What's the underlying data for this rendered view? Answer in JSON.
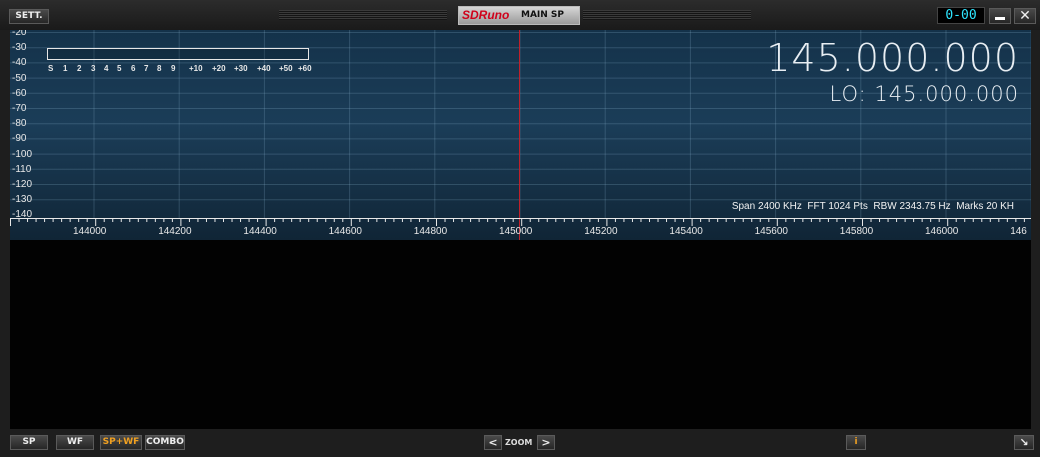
{
  "window": {
    "brand": "SDRuno",
    "title": "MAIN SP",
    "clock": "0-00",
    "settings_label": "SETT.",
    "close_label": "✕"
  },
  "spectrum": {
    "y_labels": [
      "-20",
      "-30",
      "-40",
      "-50",
      "-60",
      "-70",
      "-80",
      "-90",
      "-100",
      "-110",
      "-120",
      "-130",
      "-140"
    ],
    "smeter_labels": [
      "S",
      "1",
      "2",
      "3",
      "4",
      "5",
      "6",
      "7",
      "8",
      "9",
      "+10",
      "+20",
      "+30",
      "+40",
      "+50",
      "+60"
    ],
    "frequency": "145.000.000",
    "lo": "LO: 145.000.000",
    "info": "Span 2400 KHz  FFT 1024 Pts  RBW 2343.75 Hz  Marks 20 KH",
    "x_labels": [
      "144000",
      "144200",
      "144400",
      "144600",
      "144800",
      "145000",
      "145200",
      "145400",
      "145600",
      "145800",
      "146000",
      "146"
    ],
    "marker_color": "#c0202a"
  },
  "bottom": {
    "sp": "SP",
    "wf": "WF",
    "spwf": "SP+WF",
    "combo": "COMBO",
    "zoom_prev": "<",
    "zoom": "ZOOM",
    "zoom_next": ">",
    "info": "i",
    "resize": "↘"
  },
  "colors": {
    "accent": "#f0a020",
    "clock_digits": "#2ee6ff",
    "spectrum_bg": "#1b3d58"
  }
}
